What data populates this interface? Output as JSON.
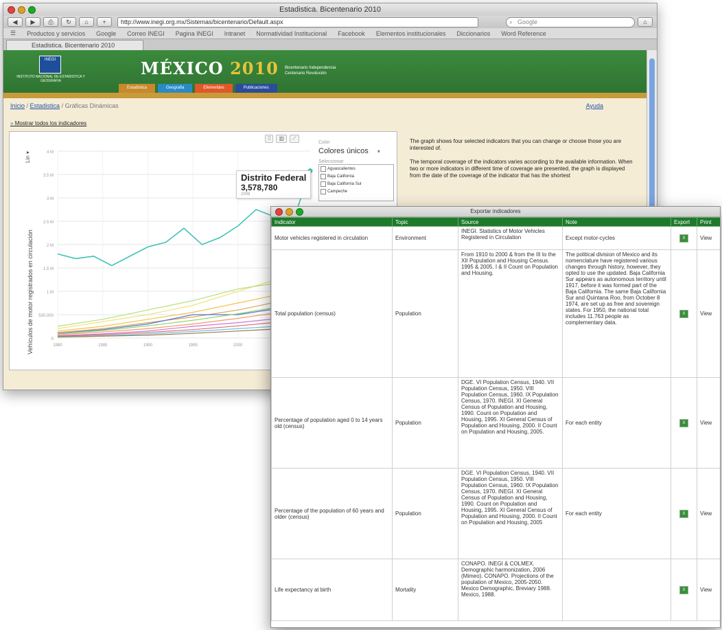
{
  "browser": {
    "title": "Estadistica. Bicentenario 2010",
    "url": "http://www.inegi.org.mx/Sistemas/bicentenario/Default.aspx",
    "search_placeholder": "Google",
    "bookmarks": [
      "Productos y servicios",
      "Google",
      "Correo INEGI",
      "Pagina INEGI",
      "Intranet",
      "Normatividad Institucional",
      "Facebook",
      "Elementos institucionales",
      "Diccionarios",
      "Word Reference"
    ],
    "tab": "Estadistica. Bicentenario 2010"
  },
  "site": {
    "logo_text": "INEGI",
    "institute": "INSTITUTO NACIONAL DE ESTADISTICA Y GEOGRAFIA",
    "brand_word": "MÉXICO",
    "brand_year": "2010",
    "tagline_1": "Bicentenario Independencia",
    "tagline_2": "Centenario Revolución",
    "nav": [
      "Estadistica",
      "Geografia",
      "Efemerides",
      "Publicaciones"
    ],
    "nav_colors": [
      "#c7892b",
      "#2a8bc4",
      "#e0582a",
      "#2a4d9a"
    ]
  },
  "breadcrumb": {
    "home": "Inicio",
    "sep": " / ",
    "section": "Estadistica",
    "current": "Gráficas Dinámicas"
  },
  "help": "Ayuda",
  "show_all": "Mostrar todos los indicadores",
  "chart_panel": {
    "scale_label": "Lin",
    "color_label": "Color",
    "color_value": "Colores únicos",
    "select_label": "Seleccionar",
    "entities": [
      "Aguascalientes",
      "Baja California",
      "Baja California Sur",
      "Campeche"
    ],
    "tooltip_name": "Distrito Federal",
    "tooltip_value": "3,578,780",
    "tooltip_year": "2008"
  },
  "chart_data": {
    "type": "line",
    "ylabel": "Vehículos de motor registrados en circulación",
    "y_ticks": [
      "0",
      "500,000",
      "1 M",
      "1.5 M",
      "2 M",
      "2.5 M",
      "3 M",
      "3.5 M",
      "4 M"
    ],
    "x_ticks": [
      "1980",
      "1985",
      "1990",
      "1995",
      "2000"
    ],
    "ylim": [
      0,
      4000000
    ],
    "xlim": [
      1980,
      2008
    ],
    "series": [
      {
        "color": "#3fc3b5",
        "x": [
          1980,
          1982,
          1984,
          1986,
          1988,
          1990,
          1992,
          1994,
          1996,
          1998,
          2000,
          2002,
          2004,
          2006,
          2008
        ],
        "values": [
          1800000,
          1700000,
          1750000,
          1550000,
          1750000,
          1950000,
          2050000,
          2350000,
          2000000,
          2150000,
          2400000,
          2750000,
          2600000,
          2450000,
          3578780
        ]
      },
      {
        "color": "#f0e27a",
        "x": [
          1980,
          1985,
          1990,
          1995,
          2000,
          2005,
          2008
        ],
        "values": [
          200000,
          350000,
          500000,
          700000,
          1000000,
          1300000,
          1450000
        ]
      },
      {
        "color": "#b5e07a",
        "x": [
          1980,
          1985,
          1990,
          1995,
          2000,
          2005,
          2008
        ],
        "values": [
          250000,
          400000,
          600000,
          800000,
          1050000,
          1200000,
          1300000
        ]
      },
      {
        "color": "#f5c24a",
        "x": [
          1980,
          1985,
          1990,
          1995,
          2000,
          2005,
          2008
        ],
        "values": [
          150000,
          250000,
          400000,
          550000,
          750000,
          950000,
          1100000
        ]
      },
      {
        "color": "#e2a35a",
        "x": [
          1980,
          1985,
          1990,
          1995,
          2000,
          2005,
          2008
        ],
        "values": [
          120000,
          200000,
          330000,
          450000,
          600000,
          800000,
          950000
        ]
      },
      {
        "color": "#4b7ad6",
        "x": [
          1980,
          1985,
          1990,
          1995,
          2000,
          2005,
          2008
        ],
        "values": [
          100000,
          180000,
          300000,
          500000,
          500000,
          650000,
          800000
        ]
      },
      {
        "color": "#8fd06a",
        "x": [
          1980,
          1985,
          1990,
          1995,
          2000,
          2005,
          2008
        ],
        "values": [
          90000,
          160000,
          260000,
          380000,
          520000,
          680000,
          750000
        ]
      },
      {
        "color": "#f29a66",
        "x": [
          1980,
          1985,
          1990,
          1995,
          2000,
          2005,
          2008
        ],
        "values": [
          70000,
          130000,
          200000,
          300000,
          420000,
          560000,
          640000
        ]
      },
      {
        "color": "#c47ad6",
        "x": [
          1980,
          1985,
          1990,
          1995,
          2000,
          2005,
          2008
        ],
        "values": [
          50000,
          90000,
          150000,
          250000,
          330000,
          430000,
          520000
        ]
      },
      {
        "color": "#e86a6a",
        "x": [
          1980,
          1985,
          1990,
          1995,
          2000,
          2005,
          2008
        ],
        "values": [
          40000,
          70000,
          120000,
          180000,
          260000,
          350000,
          420000
        ]
      },
      {
        "color": "#6ac2e8",
        "x": [
          1980,
          1985,
          1990,
          1995,
          2000,
          2005,
          2008
        ],
        "values": [
          30000,
          50000,
          90000,
          140000,
          200000,
          260000,
          320000
        ]
      },
      {
        "color": "#9a7a4a",
        "x": [
          1980,
          1985,
          1990,
          1995,
          2000,
          2005,
          2008
        ],
        "values": [
          20000,
          40000,
          60000,
          100000,
          150000,
          200000,
          240000
        ]
      }
    ]
  },
  "info": {
    "p1": "The graph shows four selected indicators that you can change or choose those you are interested of.",
    "p2": "The temporal coverage of the indicators varies according to the available information. When two or more indicators in different time of coverage are presented, the graph is displayed from the date of the coverage of the indicator that has the shortest"
  },
  "dialog": {
    "title": "Exportar indicadores",
    "headers": [
      "Indicator",
      "Topic",
      "Source",
      "Note",
      "Export",
      "Print"
    ],
    "rows": [
      {
        "indicator": "Motor vehicles registered in circulation",
        "topic": "Environment",
        "source": "INEGI. Statistics of Motor Vehicles Registered in Circulation",
        "note": "Except motor-cycles",
        "print": "View"
      },
      {
        "indicator": "Total population (census)",
        "topic": "Population",
        "source": "From 1910 to 2000 & from the III to the XII Population and Housing Census. 1995 & 2005. I & II Count on Population and Housing.",
        "note": "The political division of Mexico and its nomenclature have registered various changes through history, however, they opted to use the updated. Baja California Sur appears as autonomous territory until 1917, before it was formed part of the Baja California. The same Baja California Sur and Quintana Roo, from October 8 1974, are set up as free and sovereign states. For 1950, the national total includes 11.763 people as complementary data.",
        "print": "View"
      },
      {
        "indicator": "Percentage of population aged 0 to 14 years old (census)",
        "topic": "Population",
        "source": "DGE. VI Population Census, 1940. VII Population Census, 1950. VIII Population Census, 1960. IX Population Census, 1970. INEGI. XI General Census of Population and Housing, 1990. Count on Population and Housing, 1995. XI General Census of Population and Housing, 2000. II Count on Population and Housing, 2005.",
        "note": "For each entity",
        "print": "View"
      },
      {
        "indicator": "Percentage of the population of 60 years and older (census)",
        "topic": "Population",
        "source": "DGE. VI Population Census, 1940. VII Population Census, 1950. VIII Population Census, 1960. IX Population Census, 1970. INEGI. XI General Census of Population and Housing, 1990. Count on Population and Housing, 1995. XI General Census of Population and Housing, 2000. II Count on Population and Housing, 2005",
        "note": "For each entity",
        "print": "View"
      },
      {
        "indicator": "Life expectancy at birth",
        "topic": "Mortality",
        "source": "CONAPO. INEGI & COLMEX. Demographic harmonization, 2006 (Mimeo). CONAPO. Projections of the population of Mexico, 2005-2050. Mexico Demographic, Breviary 1988. Mexico, 1988.",
        "note": "",
        "print": "View"
      }
    ]
  }
}
